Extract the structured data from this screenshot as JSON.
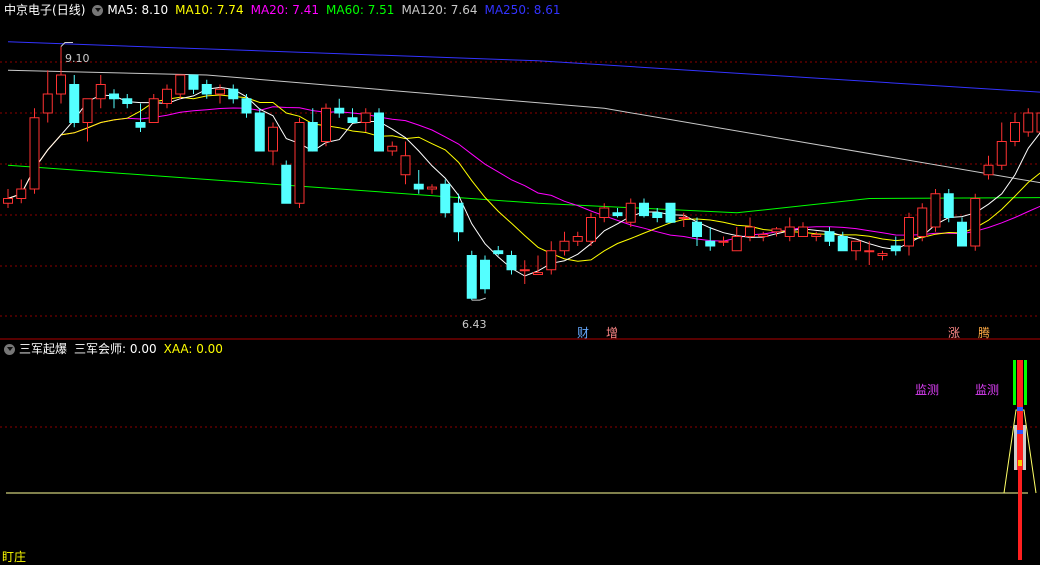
{
  "header": {
    "stock_name": "中京电子",
    "period": "(日线)",
    "ma_items": [
      {
        "label": "MA5: 8.10",
        "color": "#ffffff"
      },
      {
        "label": "MA10: 7.74",
        "color": "#ffff00"
      },
      {
        "label": "MA20: 7.41",
        "color": "#ff00ff"
      },
      {
        "label": "MA60: 7.51",
        "color": "#00ff00"
      },
      {
        "label": "MA120: 7.64",
        "color": "#c8c8c8"
      },
      {
        "label": "MA250: 8.61",
        "color": "#3333ff"
      }
    ]
  },
  "sub_header": {
    "indicator_name": "三军起爆",
    "value1": "三军会师: 0.00",
    "value2": "XAA: 0.00"
  },
  "price_labels": {
    "high": "9.10",
    "low": "6.43"
  },
  "markers": [
    {
      "text": "财",
      "color": "#66aaff"
    },
    {
      "text": "增",
      "color": "#ff8888"
    },
    {
      "text": "涨",
      "color": "#ff8888"
    },
    {
      "text": "腾",
      "color": "#ffaa44"
    }
  ],
  "signal_label": "监测",
  "footer_label": "盯庄",
  "colors": {
    "up": "#ff3232",
    "down": "#54ffff",
    "grid": "#8b0000",
    "ma5": "#ffffff",
    "ma10": "#ffff00",
    "ma20": "#ff00ff",
    "ma60": "#00ff00",
    "ma120": "#c8c8c8",
    "ma250": "#3333ff"
  },
  "chart_data": {
    "type": "candlestick",
    "y_range": [
      6.2,
      9.4
    ],
    "candles": [
      [
        7.45,
        7.6,
        7.4,
        7.5
      ],
      [
        7.5,
        7.7,
        7.45,
        7.6
      ],
      [
        7.6,
        8.45,
        7.55,
        8.35
      ],
      [
        8.4,
        8.85,
        8.3,
        8.6
      ],
      [
        8.6,
        9.1,
        8.5,
        8.8
      ],
      [
        8.7,
        8.8,
        8.25,
        8.3
      ],
      [
        8.3,
        8.55,
        8.1,
        8.55
      ],
      [
        8.55,
        8.8,
        8.45,
        8.7
      ],
      [
        8.6,
        8.65,
        8.45,
        8.55
      ],
      [
        8.55,
        8.6,
        8.45,
        8.5
      ],
      [
        8.3,
        8.5,
        8.2,
        8.25
      ],
      [
        8.3,
        8.6,
        8.3,
        8.55
      ],
      [
        8.5,
        8.7,
        8.45,
        8.65
      ],
      [
        8.6,
        8.8,
        8.55,
        8.8
      ],
      [
        8.8,
        8.8,
        8.6,
        8.65
      ],
      [
        8.7,
        8.75,
        8.55,
        8.6
      ],
      [
        8.6,
        8.7,
        8.5,
        8.65
      ],
      [
        8.65,
        8.7,
        8.5,
        8.55
      ],
      [
        8.55,
        8.6,
        8.35,
        8.4
      ],
      [
        8.4,
        8.45,
        8.0,
        8.0
      ],
      [
        8.0,
        8.3,
        7.85,
        8.25
      ],
      [
        7.85,
        7.9,
        7.45,
        7.45
      ],
      [
        7.45,
        8.35,
        7.4,
        8.3
      ],
      [
        8.3,
        8.45,
        8.0,
        8.0
      ],
      [
        8.1,
        8.5,
        8.05,
        8.45
      ],
      [
        8.45,
        8.55,
        8.35,
        8.4
      ],
      [
        8.35,
        8.45,
        8.3,
        8.3
      ],
      [
        8.3,
        8.45,
        8.2,
        8.4
      ],
      [
        8.4,
        8.45,
        8.0,
        8.0
      ],
      [
        8.0,
        8.1,
        7.95,
        8.05
      ],
      [
        7.75,
        8.1,
        7.65,
        7.95
      ],
      [
        7.65,
        7.8,
        7.55,
        7.6
      ],
      [
        7.6,
        7.65,
        7.55,
        7.62
      ],
      [
        7.65,
        7.7,
        7.3,
        7.35
      ],
      [
        7.45,
        7.55,
        7.05,
        7.15
      ],
      [
        6.9,
        6.95,
        6.43,
        6.45
      ],
      [
        6.85,
        6.9,
        6.5,
        6.55
      ],
      [
        6.95,
        7.0,
        6.9,
        6.92
      ],
      [
        6.9,
        6.95,
        6.7,
        6.75
      ],
      [
        6.75,
        6.85,
        6.6,
        6.75
      ],
      [
        6.7,
        6.9,
        6.7,
        6.72
      ],
      [
        6.75,
        7.05,
        6.7,
        6.95
      ],
      [
        6.95,
        7.15,
        6.9,
        7.05
      ],
      [
        7.05,
        7.15,
        7.0,
        7.1
      ],
      [
        7.05,
        7.35,
        7.0,
        7.3
      ],
      [
        7.3,
        7.45,
        7.25,
        7.4
      ],
      [
        7.35,
        7.4,
        7.3,
        7.32
      ],
      [
        7.25,
        7.5,
        7.2,
        7.45
      ],
      [
        7.45,
        7.5,
        7.3,
        7.32
      ],
      [
        7.35,
        7.4,
        7.25,
        7.3
      ],
      [
        7.45,
        7.45,
        7.25,
        7.25
      ],
      [
        7.3,
        7.35,
        7.2,
        7.3
      ],
      [
        7.25,
        7.3,
        7.0,
        7.1
      ],
      [
        7.05,
        7.2,
        6.95,
        7.0
      ],
      [
        7.05,
        7.1,
        7.0,
        7.05
      ],
      [
        6.95,
        7.2,
        6.95,
        7.1
      ],
      [
        7.1,
        7.3,
        7.05,
        7.2
      ],
      [
        7.1,
        7.15,
        7.05,
        7.12
      ],
      [
        7.15,
        7.2,
        7.1,
        7.18
      ],
      [
        7.1,
        7.3,
        7.05,
        7.2
      ],
      [
        7.1,
        7.25,
        7.1,
        7.2
      ],
      [
        7.1,
        7.15,
        7.05,
        7.12
      ],
      [
        7.15,
        7.2,
        7.0,
        7.05
      ],
      [
        7.1,
        7.15,
        6.95,
        6.95
      ],
      [
        6.95,
        7.05,
        6.85,
        7.05
      ],
      [
        6.95,
        7.05,
        6.8,
        6.95
      ],
      [
        6.9,
        6.95,
        6.85,
        6.92
      ],
      [
        7.0,
        7.1,
        6.9,
        6.95
      ],
      [
        7.0,
        7.35,
        6.9,
        7.3
      ],
      [
        7.1,
        7.45,
        7.05,
        7.4
      ],
      [
        7.2,
        7.6,
        7.15,
        7.55
      ],
      [
        7.55,
        7.6,
        7.25,
        7.3
      ],
      [
        7.25,
        7.3,
        7.0,
        7.0
      ],
      [
        7.0,
        7.55,
        6.95,
        7.5
      ],
      [
        7.75,
        7.95,
        7.7,
        7.85
      ],
      [
        7.85,
        8.3,
        7.8,
        8.1
      ],
      [
        8.1,
        8.4,
        8.05,
        8.3
      ],
      [
        8.2,
        8.45,
        8.15,
        8.4
      ],
      [
        8.2,
        8.95,
        8.05,
        8.4
      ],
      [
        8.35,
        8.5,
        8.2,
        8.2
      ]
    ],
    "ma250": [
      [
        0,
        9.15
      ],
      [
        40,
        8.95
      ],
      [
        79,
        8.61
      ]
    ],
    "ma120": [
      [
        0,
        8.85
      ],
      [
        15,
        8.8
      ],
      [
        45,
        8.45
      ],
      [
        79,
        7.64
      ]
    ],
    "ma60": [
      [
        0,
        7.85
      ],
      [
        20,
        7.65
      ],
      [
        40,
        7.45
      ],
      [
        55,
        7.35
      ],
      [
        65,
        7.5
      ],
      [
        79,
        7.51
      ]
    ],
    "signals": [
      {
        "bar": 76
      },
      {
        "bar": 79
      }
    ]
  }
}
